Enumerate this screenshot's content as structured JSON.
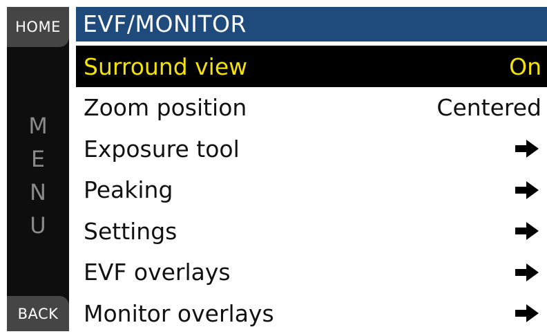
{
  "sidebar": {
    "home_label": "HOME",
    "back_label": "BACK",
    "menu_letters": [
      "M",
      "E",
      "N",
      "U"
    ]
  },
  "header": {
    "title": "EVF/MONITOR"
  },
  "menu": {
    "items": [
      {
        "label": "Surround view",
        "value": "On",
        "type": "value",
        "selected": true
      },
      {
        "label": "Zoom position",
        "value": "Centered",
        "type": "value",
        "selected": false
      },
      {
        "label": "Exposure tool",
        "value": "",
        "type": "submenu",
        "icon": "arrow-right-icon",
        "selected": false
      },
      {
        "label": "Peaking",
        "value": "",
        "type": "submenu",
        "icon": "arrow-right-icon",
        "selected": false
      },
      {
        "label": "Settings",
        "value": "",
        "type": "submenu",
        "icon": "arrow-right-icon",
        "selected": false
      },
      {
        "label": "EVF overlays",
        "value": "",
        "type": "submenu",
        "icon": "arrow-right-icon",
        "selected": false
      },
      {
        "label": "Monitor overlays",
        "value": "",
        "type": "submenu",
        "icon": "arrow-right-icon",
        "selected": false
      }
    ]
  },
  "colors": {
    "title_bar": "#1f4a7c",
    "selected_bg": "#000000",
    "selected_text": "#f2e10a",
    "sidebar_bg": "#0e0e0e",
    "sidebar_button": "#454545"
  }
}
